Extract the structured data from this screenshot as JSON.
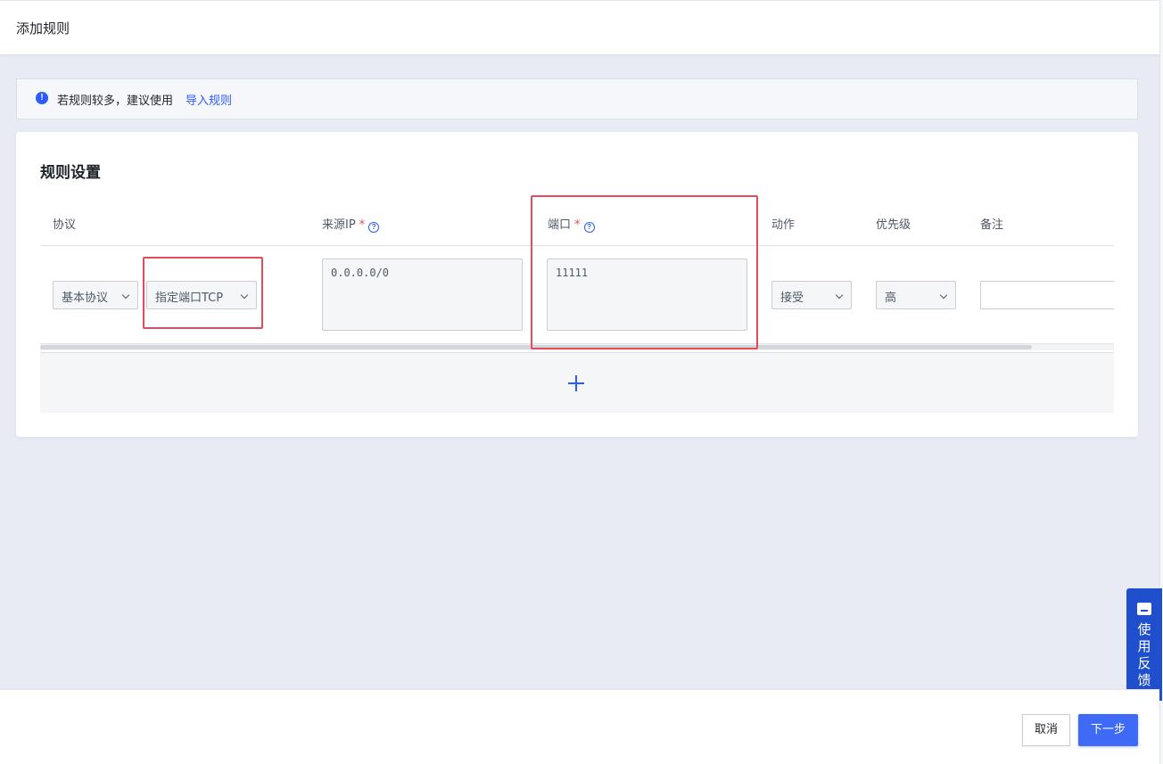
{
  "page": {
    "title": "添加规则"
  },
  "tip": {
    "text": "若规则较多，建议使用",
    "link": "导入规则",
    "icon": "info-icon"
  },
  "card": {
    "title": "规则设置",
    "columns": {
      "protocol": "协议",
      "source_ip": "来源IP",
      "port": "端口",
      "action": "动作",
      "priority": "优先级",
      "remark": "备注",
      "required_mark": "*"
    },
    "row": {
      "protocol_type": "基本协议",
      "protocol": "指定端口TCP",
      "source_ip": "0.0.0.0/0",
      "port": "11111",
      "action": "接受",
      "priority": "高",
      "remark": ""
    },
    "add_row_icon": "plus-icon"
  },
  "feedback": {
    "label": "使用反馈",
    "icon": "feedback-icon"
  },
  "footer": {
    "cancel_label": "取消",
    "next_label": "下一步"
  },
  "colors": {
    "accent": "#2b5cff",
    "highlight": "#e34d59",
    "background": "#e8ebf3"
  }
}
